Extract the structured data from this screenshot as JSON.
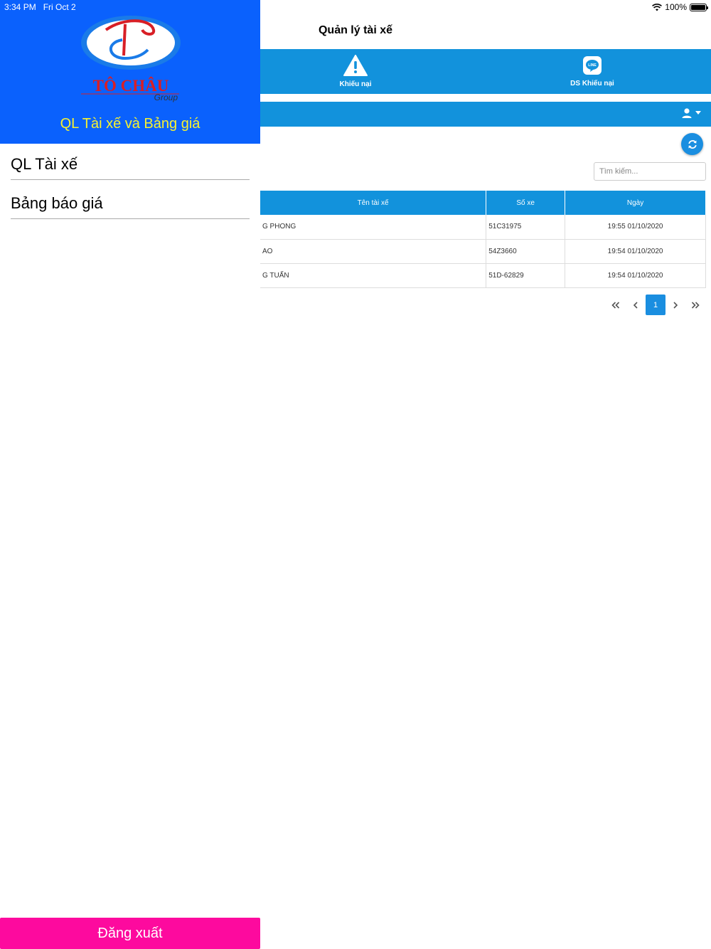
{
  "status_bar": {
    "time": "3:34 PM",
    "date": "Fri Oct 2",
    "battery": "100%"
  },
  "main": {
    "title": "Quản lý tài xế",
    "tabs": [
      {
        "label": "Khiếu nại",
        "icon": "warning-icon"
      },
      {
        "label": "DS Khiếu nại",
        "icon": "line-chat-icon"
      }
    ],
    "search": {
      "placeholder": "Tìm kiếm..."
    },
    "table": {
      "headers": [
        "Tên tài xế",
        "Số xe",
        "Ngày"
      ],
      "rows": [
        {
          "name": "G PHONG",
          "plate": "51C31975",
          "date": "19:55 01/10/2020"
        },
        {
          "name": "AO",
          "plate": "54Z3660",
          "date": "19:54 01/10/2020"
        },
        {
          "name": "G TUẤN",
          "plate": "51D-62829",
          "date": "19:54 01/10/2020"
        }
      ]
    },
    "pagination": {
      "current": "1"
    }
  },
  "drawer": {
    "logo": {
      "brand": "TÔ CHÂU",
      "sub": "Group"
    },
    "subtitle": "QL Tài xế và Bảng giá",
    "menu": [
      {
        "label": "QL Tài xế"
      },
      {
        "label": "Bảng báo giá"
      }
    ],
    "logout_label": "Đăng xuất"
  },
  "colors": {
    "primary_blue": "#1292dc",
    "drawer_header": "#0a61fd",
    "subtitle_yellow": "#f7f230",
    "logout_pink": "#fd0a9e"
  }
}
